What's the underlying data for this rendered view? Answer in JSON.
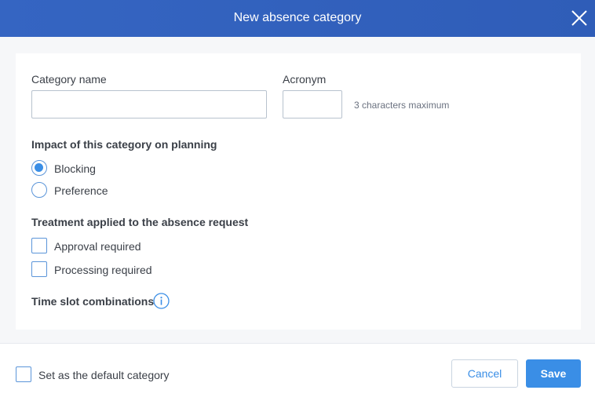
{
  "dialog": {
    "title": "New absence category",
    "close_icon": "close-icon"
  },
  "form": {
    "category_name": {
      "label": "Category name",
      "value": "",
      "placeholder": ""
    },
    "acronym": {
      "label": "Acronym",
      "value": "",
      "placeholder": "",
      "hint": "3 characters maximum"
    },
    "impact": {
      "title": "Impact of this category on planning",
      "options": [
        {
          "label": "Blocking",
          "selected": true
        },
        {
          "label": "Preference",
          "selected": false
        }
      ]
    },
    "treatment": {
      "title": "Treatment applied to the absence request",
      "options": [
        {
          "label": "Approval required",
          "checked": false
        },
        {
          "label": "Processing required",
          "checked": false
        }
      ]
    },
    "time_slot": {
      "title": "Time slot combinations",
      "icon": "info-icon"
    }
  },
  "footer": {
    "default_checkbox_label": "Set as the default category",
    "default_checked": false,
    "cancel_label": "Cancel",
    "save_label": "Save"
  },
  "colors": {
    "header": "#3565c2",
    "accent": "#3a8ee6",
    "panel_bg": "#ffffff",
    "page_bg": "#f6f7f9"
  }
}
